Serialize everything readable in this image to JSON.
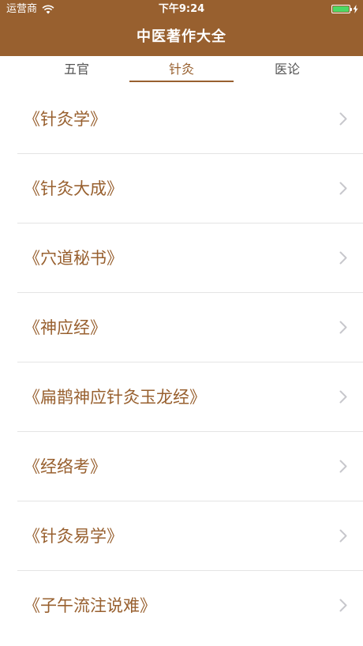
{
  "status_bar": {
    "carrier": "运营商",
    "time": "下午9:24",
    "battery_level": 1.0
  },
  "header": {
    "title": "中医著作大全"
  },
  "tabs": [
    {
      "label": "五官",
      "active": false
    },
    {
      "label": "针灸",
      "active": true
    },
    {
      "label": "医论",
      "active": false
    }
  ],
  "list": {
    "items": [
      {
        "label": "《针灸学》"
      },
      {
        "label": "《针灸大成》"
      },
      {
        "label": "《穴道秘书》"
      },
      {
        "label": "《神应经》"
      },
      {
        "label": "《扁鹊神应针灸玉龙经》"
      },
      {
        "label": "《经络考》"
      },
      {
        "label": "《针灸易学》"
      },
      {
        "label": "《子午流注说难》"
      }
    ]
  },
  "icons": {
    "wifi": "wifi-icon",
    "battery": "battery-icon",
    "charging": "charging-icon",
    "chevron": "chevron-right-icon"
  },
  "colors": {
    "brand": "#98602f",
    "battery_fill": "#4cd964",
    "divider": "#e4e4e4",
    "chevron": "#c7c7cc"
  }
}
